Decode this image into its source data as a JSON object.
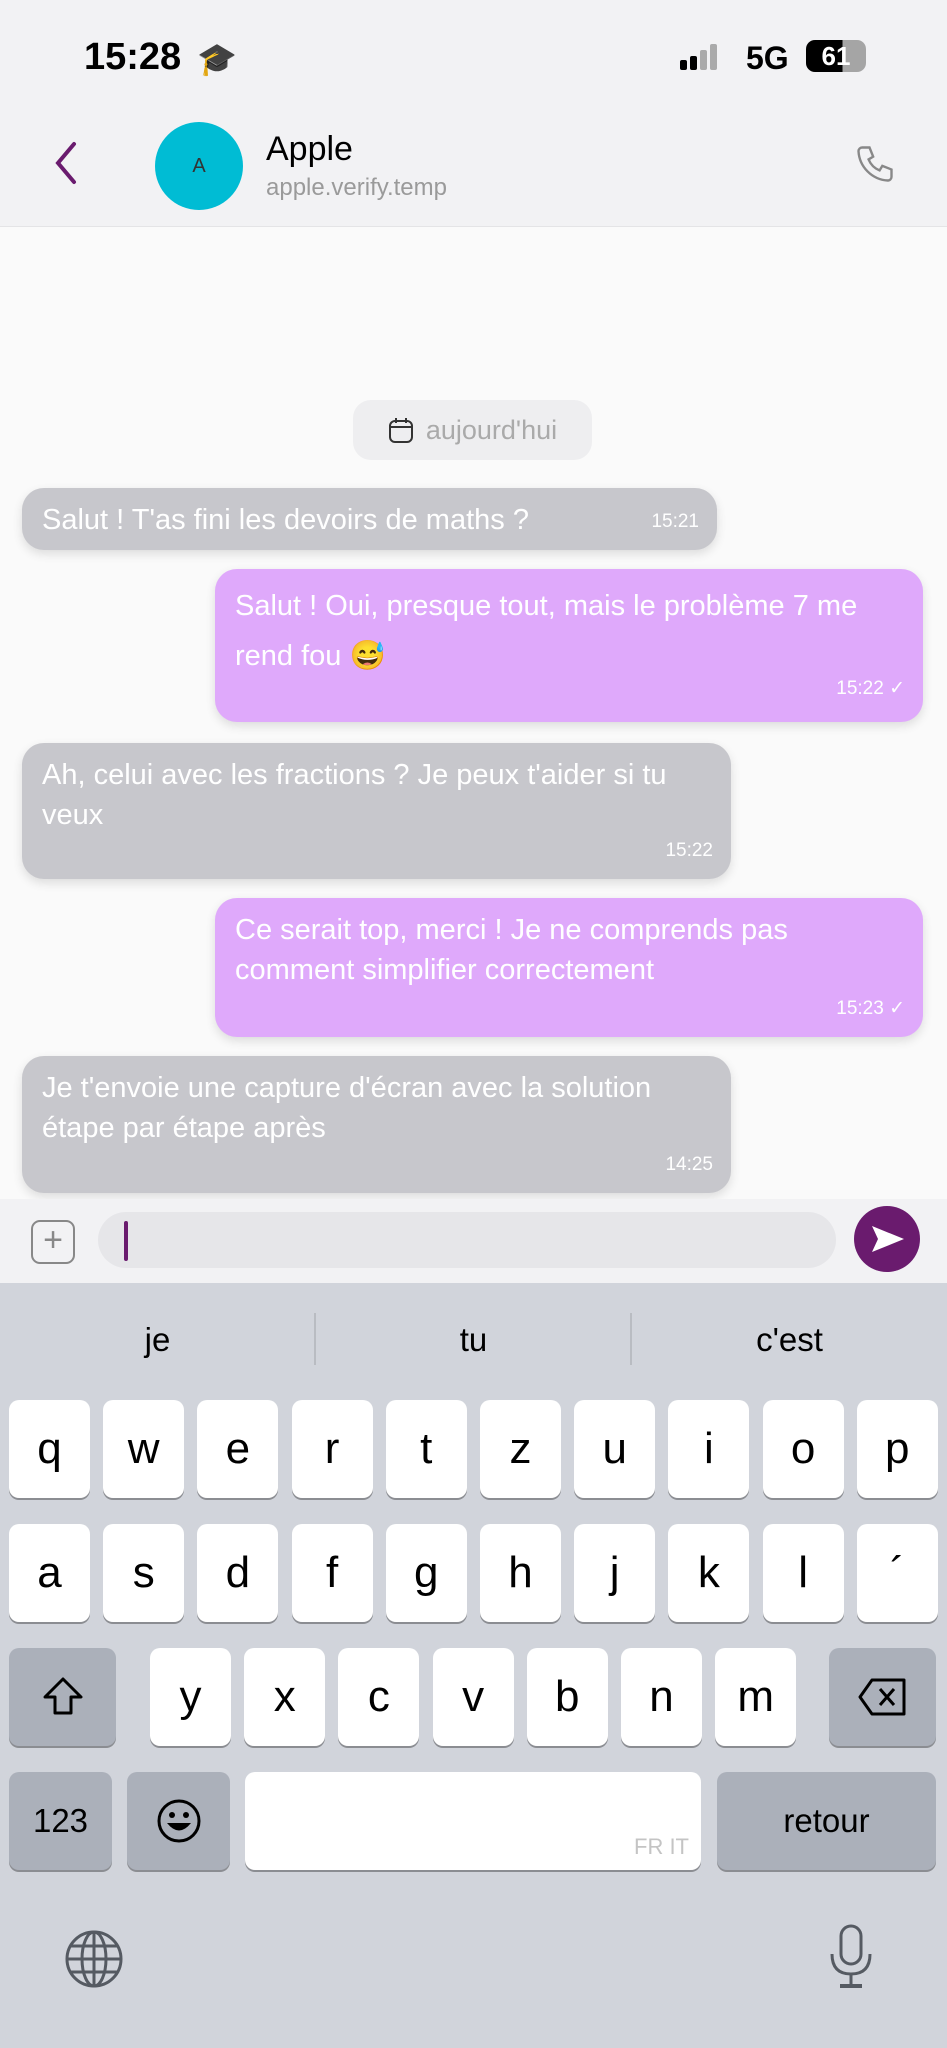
{
  "status_bar": {
    "time": "15:28",
    "network": "5G",
    "battery": "61",
    "focus_icon": "graduation-cap-icon"
  },
  "header": {
    "avatar_letter": "A",
    "name": "Apple",
    "subtitle": "apple.verify.temp",
    "avatar_color": "#00bcd4",
    "accent": "#6a1b6e"
  },
  "chat": {
    "date_label": "aujourd'hui",
    "messages": [
      {
        "dir": "received",
        "text": "Salut ! T'as fini les devoirs de maths ?",
        "time": "15:21"
      },
      {
        "dir": "sent",
        "text": "Salut ! Oui, presque tout, mais le problème 7 me rend fou 😅",
        "time": "15:22 ✓"
      },
      {
        "dir": "received",
        "text": "Ah, celui avec les fractions ? Je peux t'aider si tu veux",
        "time": "15:22"
      },
      {
        "dir": "sent",
        "text": "Ce serait top, merci ! Je ne comprends pas comment simplifier correctement",
        "time": "15:23 ✓"
      },
      {
        "dir": "received",
        "text": "Je t'envoie une capture d'écran avec la solution étape par étape après",
        "time": "14:25"
      }
    ]
  },
  "input": {
    "value": ""
  },
  "keyboard": {
    "suggestions": [
      "je",
      "tu",
      "c'est"
    ],
    "row1": [
      "q",
      "w",
      "e",
      "r",
      "t",
      "z",
      "u",
      "i",
      "o",
      "p"
    ],
    "row2": [
      "a",
      "s",
      "d",
      "f",
      "g",
      "h",
      "j",
      "k",
      "l",
      "´"
    ],
    "row3": [
      "y",
      "x",
      "c",
      "v",
      "b",
      "n",
      "m"
    ],
    "numbers_key": "123",
    "space_languages": "FR IT",
    "return_key": "retour"
  }
}
